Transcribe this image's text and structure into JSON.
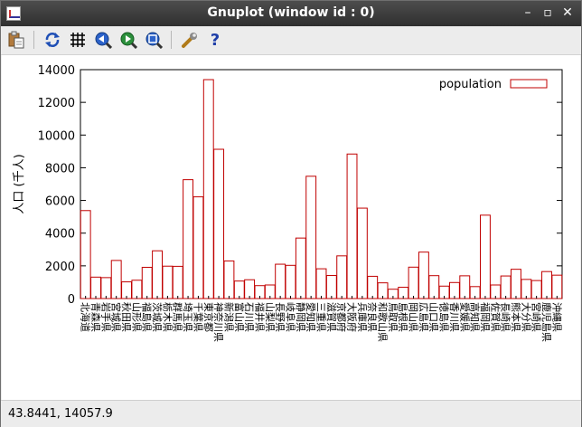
{
  "window": {
    "title": "Gnuplot (window id : 0)",
    "minimize_glyph": "–",
    "maximize_glyph": "▫",
    "close_glyph": "✕"
  },
  "toolbar": {
    "items": [
      "copy-clipboard-icon",
      "replot-icon",
      "grid-icon",
      "zoom-prev-icon",
      "zoom-next-icon",
      "autoscale-icon",
      "options-icon",
      "help-icon"
    ],
    "help_glyph": "?"
  },
  "status": {
    "coordinates": "43.8441,  14057.9"
  },
  "colors": {
    "bar_stroke": "#c00000",
    "axis": "#000000"
  },
  "chart_data": {
    "type": "bar",
    "title": "",
    "xlabel": "",
    "ylabel": "人口 (千人)",
    "ylim": [
      0,
      14000
    ],
    "yticks": [
      0,
      2000,
      4000,
      6000,
      8000,
      10000,
      12000,
      14000
    ],
    "grid": false,
    "legend": "top-right",
    "categories": [
      "北海道",
      "青森県",
      "岩手県",
      "宮城県",
      "秋田県",
      "山形県",
      "福島県",
      "茨城県",
      "栃木県",
      "群馬県",
      "埼玉県",
      "千葉県",
      "東京都",
      "神奈川県",
      "新潟県",
      "富山県",
      "石川県",
      "福井県",
      "山梨県",
      "長野県",
      "岐阜県",
      "静岡県",
      "愛知県",
      "三重県",
      "滋賀県",
      "京都府",
      "大阪府",
      "兵庫県",
      "奈良県",
      "和歌山県",
      "鳥取県",
      "島根県",
      "岡山県",
      "広島県",
      "山口県",
      "徳島県",
      "香川県",
      "愛媛県",
      "高知県",
      "福岡県",
      "佐賀県",
      "長崎県",
      "熊本県",
      "大分県",
      "宮崎県",
      "鹿児島県",
      "沖縄県"
    ],
    "series": [
      {
        "name": "population",
        "values": [
          5380,
          1310,
          1280,
          2330,
          1020,
          1120,
          1910,
          2920,
          1980,
          1970,
          7270,
          6220,
          13390,
          9130,
          2300,
          1070,
          1150,
          790,
          830,
          2100,
          2030,
          3700,
          7480,
          1820,
          1410,
          2610,
          8840,
          5530,
          1360,
          960,
          570,
          690,
          1920,
          2840,
          1400,
          760,
          980,
          1390,
          730,
          5100,
          830,
          1380,
          1790,
          1170,
          1100,
          1650,
          1430
        ]
      }
    ]
  }
}
